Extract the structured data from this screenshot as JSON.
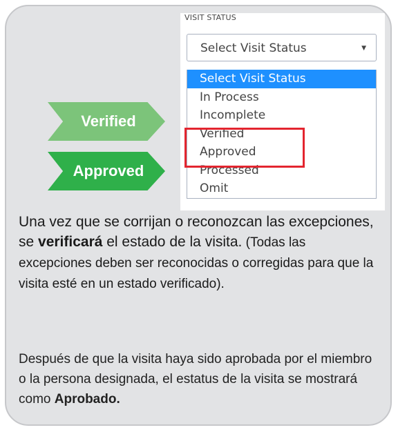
{
  "screenshot": {
    "label": "VISIT STATUS",
    "select_value": "Select Visit Status",
    "options": [
      {
        "label": "Select Visit Status",
        "active": true
      },
      {
        "label": "In Process",
        "active": false
      },
      {
        "label": "Incomplete",
        "active": false
      },
      {
        "label": "Verified",
        "active": false
      },
      {
        "label": "Approved",
        "active": false
      },
      {
        "label": "Processed",
        "active": false
      },
      {
        "label": "Omit",
        "active": false
      }
    ]
  },
  "tags": {
    "verified": "Verified",
    "approved": "Approved"
  },
  "paragraph1": {
    "part1": "Una vez que se corrijan o reconozcan las excepciones, se ",
    "bold": "verificará",
    "part2": " el estado de la visita.",
    "note": " (Todas las excepciones deben ser reconocidas o corregidas para que la visita esté en un estado verificado)."
  },
  "paragraph2": {
    "part1": "Después de que la visita haya sido aprobada por el miembro o la persona designada, el estatus de la visita se mostrará como ",
    "bold": "Aprobado."
  },
  "colors": {
    "card_bg": "#e2e3e5",
    "active_option": "#1e90ff",
    "highlight": "#e3252f",
    "tag_verified": "#7cc47a",
    "tag_approved": "#2fb04a"
  }
}
